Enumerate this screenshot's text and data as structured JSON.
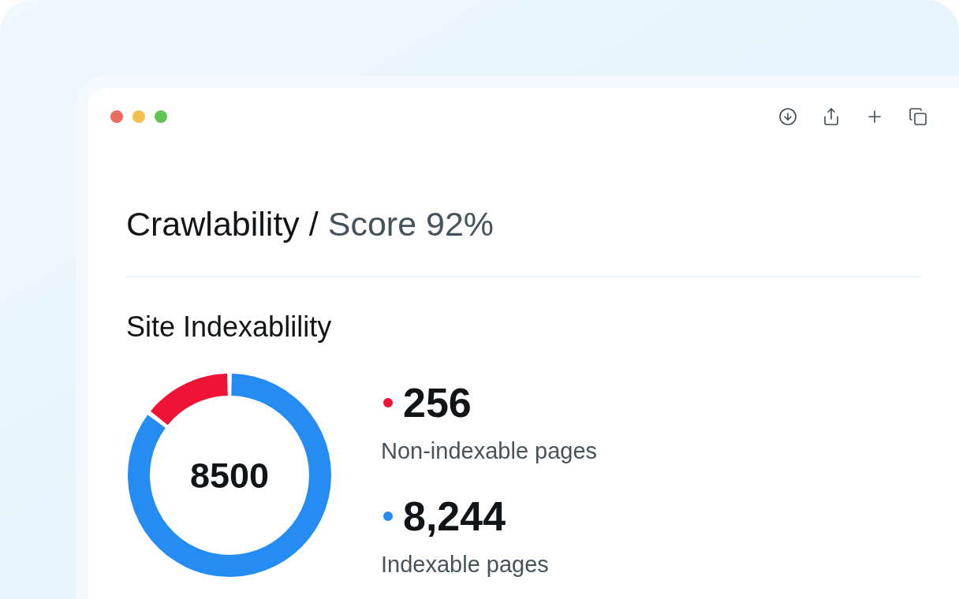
{
  "header": {
    "title": "Crawlability /",
    "subtitle": "Score 92%"
  },
  "section": {
    "title": "Site Indexablility",
    "donut": {
      "center_label": "8500",
      "chart_data": {
        "type": "donut",
        "values": [
          0.145,
          0.855
        ]
      }
    },
    "stats": [
      {
        "value": "256",
        "label": "Non-indexable pages",
        "color": "#ef1436"
      },
      {
        "value": "8,244",
        "label": "Indexable pages",
        "color": "#248cf2"
      }
    ]
  }
}
